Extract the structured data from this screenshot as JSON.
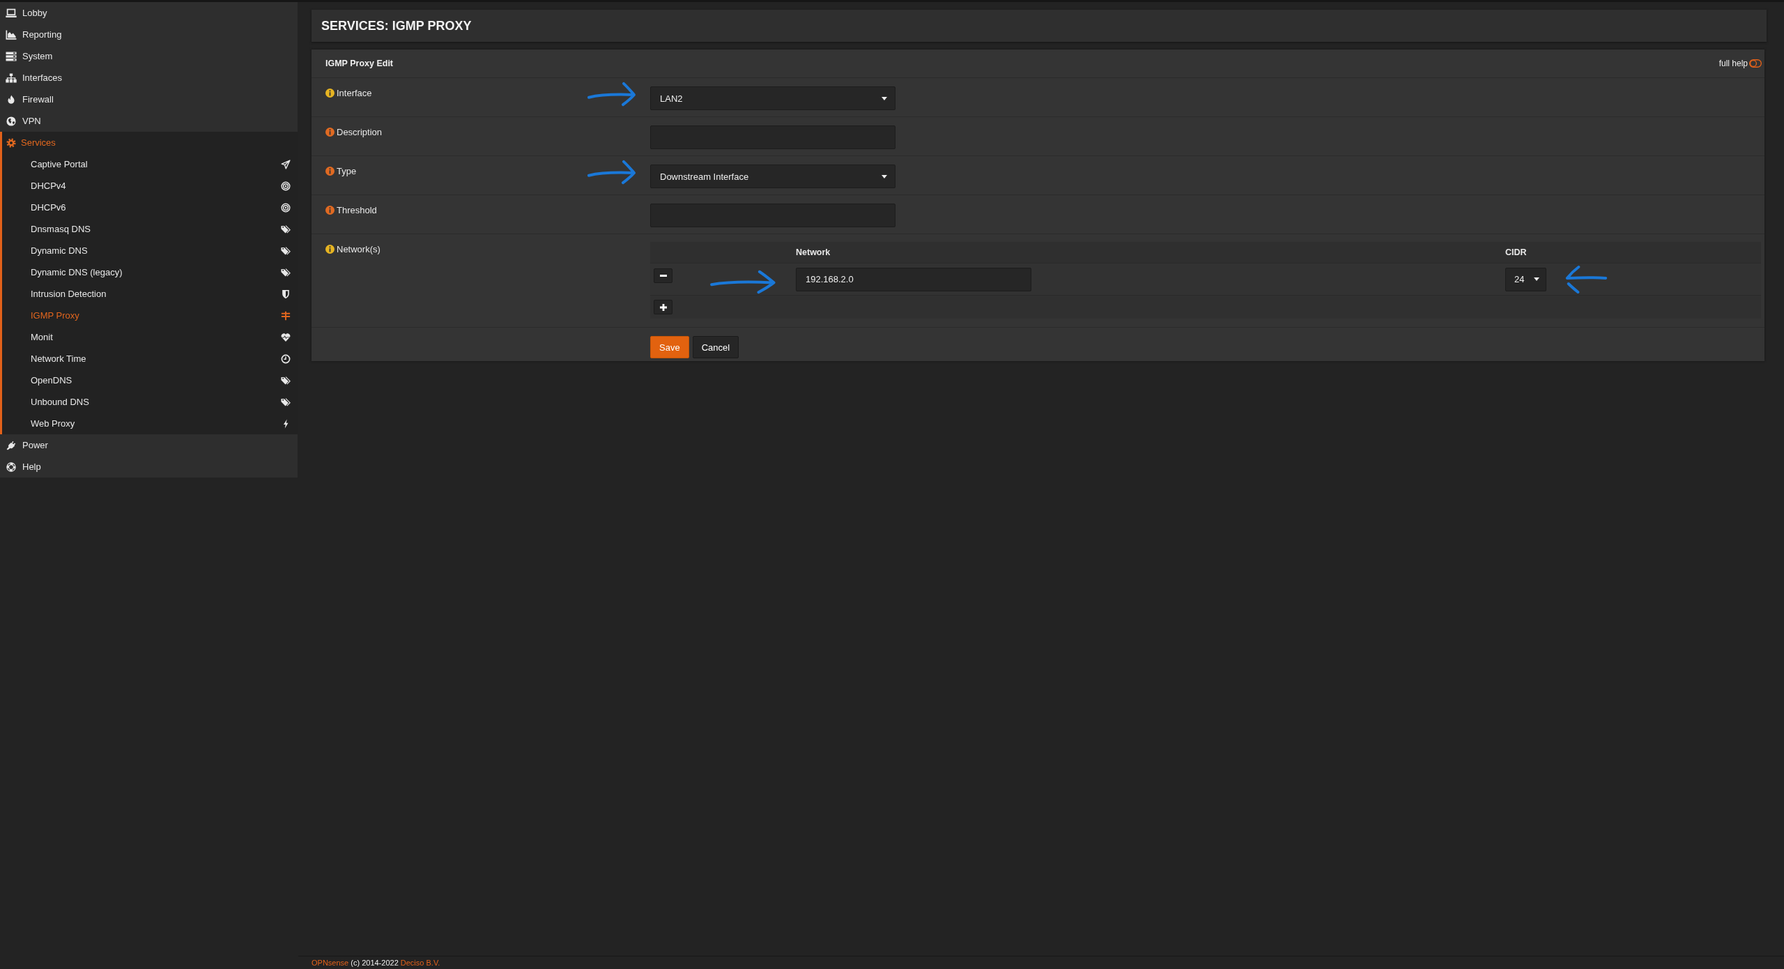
{
  "sidebar": {
    "items": [
      {
        "label": "Lobby",
        "selected": false
      },
      {
        "label": "Reporting",
        "selected": false
      },
      {
        "label": "System",
        "selected": false
      },
      {
        "label": "Interfaces",
        "selected": false
      },
      {
        "label": "Firewall",
        "selected": false
      },
      {
        "label": "VPN",
        "selected": false
      },
      {
        "label": "Services",
        "selected": true,
        "children": [
          {
            "label": "Captive Portal",
            "selected": false
          },
          {
            "label": "DHCPv4",
            "selected": false
          },
          {
            "label": "DHCPv6",
            "selected": false
          },
          {
            "label": "Dnsmasq DNS",
            "selected": false
          },
          {
            "label": "Dynamic DNS",
            "selected": false
          },
          {
            "label": "Dynamic DNS (legacy)",
            "selected": false
          },
          {
            "label": "Intrusion Detection",
            "selected": false
          },
          {
            "label": "IGMP Proxy",
            "selected": true
          },
          {
            "label": "Monit",
            "selected": false
          },
          {
            "label": "Network Time",
            "selected": false
          },
          {
            "label": "OpenDNS",
            "selected": false
          },
          {
            "label": "Unbound DNS",
            "selected": false
          },
          {
            "label": "Web Proxy",
            "selected": false
          }
        ]
      },
      {
        "label": "Power",
        "selected": false
      },
      {
        "label": "Help",
        "selected": false
      }
    ]
  },
  "page_title": "SERVICES: IGMP PROXY",
  "form": {
    "title": "IGMP Proxy Edit",
    "full_help": {
      "label": "full help",
      "on": false
    },
    "fields": [
      {
        "kind": "select",
        "label": "Interface",
        "color": "#e6b422",
        "value": "LAN2",
        "annotated": true
      },
      {
        "kind": "text",
        "label": "Description",
        "color": "#e06a22",
        "annotated": false
      },
      {
        "kind": "select",
        "label": "Type",
        "color": "#e06a22",
        "value": "Downstream Interface",
        "annotated": true
      },
      {
        "kind": "text",
        "label": "Threshold",
        "color": "#e06a22",
        "annotated": false
      },
      {
        "kind": "table",
        "label": "Network(s)",
        "color": "#e6b422",
        "annotated": false,
        "columns": [
          "Network",
          "CIDR"
        ],
        "rows": [
          {
            "network": {
              "value": "192.168.2.0",
              "annotated": true
            },
            "cidr": {
              "value": "24",
              "annotated": true
            }
          }
        ]
      }
    ],
    "buttons": [
      {
        "kind": "primary",
        "label": "Save"
      },
      {
        "kind": "default",
        "label": "Cancel"
      }
    ]
  },
  "footer": {
    "brand": "OPNsense",
    "text": "(c) 2014-2022",
    "company": "Deciso B.V."
  }
}
